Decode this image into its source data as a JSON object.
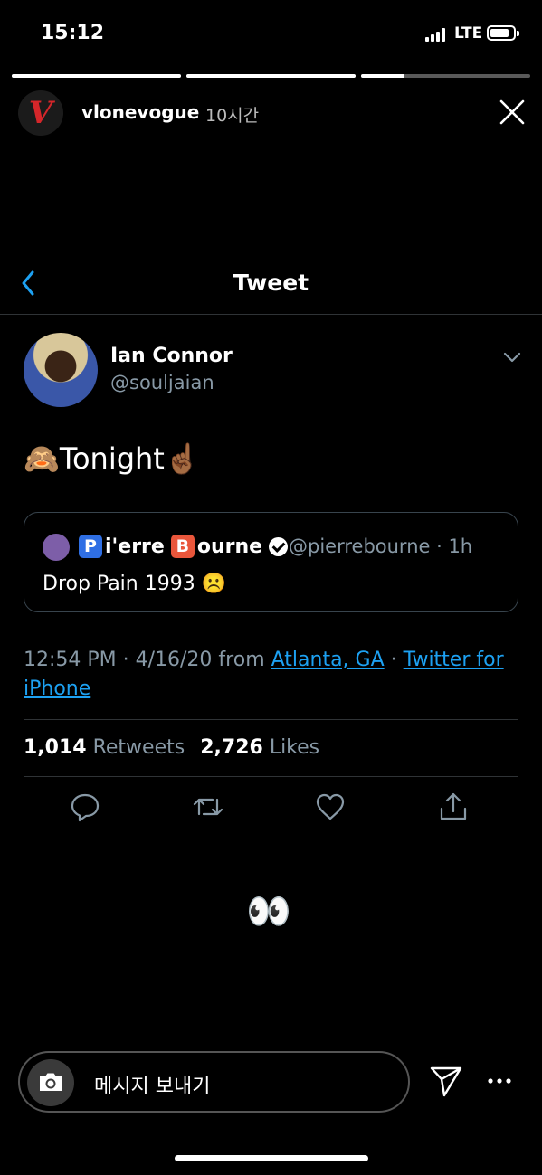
{
  "status_bar": {
    "time": "15:12",
    "network": "LTE",
    "battery_percent": 80
  },
  "story": {
    "progress": [
      1.0,
      1.0,
      0.25
    ],
    "avatar_letter": "V",
    "username": "vlonevogue",
    "posted_ago": "10시간",
    "accent_color": "#d5262a"
  },
  "tweet_nav": {
    "title": "Tweet"
  },
  "tweet": {
    "author_name": "Ian Connor",
    "author_handle": "@souljaian",
    "text": "🙈Tonight☝🏾",
    "quoted": {
      "name_parts": [
        "P",
        "i'erre",
        "B",
        "ourne"
      ],
      "handle_time": "@pierrebourne · 1h",
      "text": "Drop Pain 1993 ☹️"
    },
    "timestamp": "12:54 PM · 4/16/20 from",
    "location": "Atlanta, GA",
    "separator": "·",
    "source": "Twitter for iPhone",
    "retweets_count": "1,014",
    "retweets_label": "Retweets",
    "likes_count": "2,726",
    "likes_label": "Likes",
    "link_color": "#1da1f2"
  },
  "sticker": "👀",
  "reply_bar": {
    "placeholder": "메시지 보내기"
  }
}
